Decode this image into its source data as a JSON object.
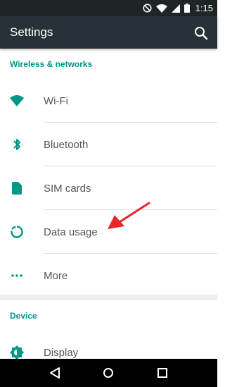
{
  "status_bar": {
    "time": "1:15",
    "icons": [
      "do-not-disturb-icon",
      "wifi-icon",
      "signal-icon",
      "battery-icon"
    ]
  },
  "toolbar": {
    "title": "Settings",
    "search_icon": "search-icon"
  },
  "sections": [
    {
      "header": "Wireless & networks",
      "items": [
        {
          "label": "Wi-Fi",
          "icon": "wifi-icon"
        },
        {
          "label": "Bluetooth",
          "icon": "bluetooth-icon"
        },
        {
          "label": "SIM cards",
          "icon": "sim-card-icon"
        },
        {
          "label": "Data usage",
          "icon": "data-usage-icon"
        },
        {
          "label": "More",
          "icon": "more-icon"
        }
      ]
    },
    {
      "header": "Device",
      "items": [
        {
          "label": "Display",
          "icon": "display-icon"
        }
      ]
    }
  ],
  "nav_bar": {
    "icons": [
      "back-icon",
      "home-icon",
      "recents-icon"
    ]
  },
  "colors": {
    "accent": "#009688",
    "toolbar": "#263238",
    "status_bar": "#1f2427",
    "annotation_arrow": "#e8262b"
  }
}
